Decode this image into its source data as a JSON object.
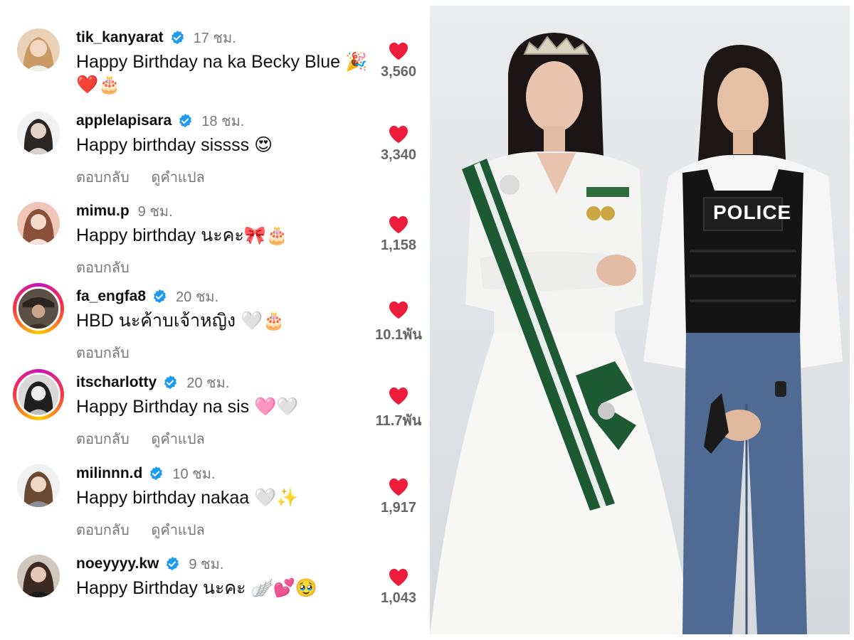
{
  "comments": [
    {
      "username": "tik_kanyarat",
      "verified": true,
      "time": "17 ชม.",
      "text": "Happy Birthday na ka Becky Blue 🎉❤️🎂",
      "actions": [],
      "likes": "3,560",
      "avatar_ring": false
    },
    {
      "username": "applelapisara",
      "verified": true,
      "time": "18 ชม.",
      "text": "Happy birthday sissss 😍",
      "actions": [
        "ตอบกลับ",
        "ดูคำแปล"
      ],
      "likes": "3,340",
      "avatar_ring": false
    },
    {
      "username": "mimu.p",
      "verified": false,
      "time": "9 ชม.",
      "text": "Happy birthday นะคะ🎀🎂",
      "actions": [
        "ตอบกลับ"
      ],
      "likes": "1,158",
      "avatar_ring": false
    },
    {
      "username": "fa_engfa8",
      "verified": true,
      "time": "20 ชม.",
      "text": "HBD นะค้าบเจ้าหญิง 🤍🎂",
      "actions": [
        "ตอบกลับ"
      ],
      "likes": "10.1พัน",
      "avatar_ring": true
    },
    {
      "username": "itscharlotty",
      "verified": true,
      "time": "20 ชม.",
      "text": "Happy Birthday na sis 🩷🤍",
      "actions": [
        "ตอบกลับ",
        "ดูคำแปล"
      ],
      "likes": "11.7พัน",
      "avatar_ring": true
    },
    {
      "username": "milinnn.d",
      "verified": true,
      "time": "10 ชม.",
      "text": "Happy birthday nakaa 🤍✨",
      "actions": [
        "ตอบกลับ",
        "ดูคำแปล"
      ],
      "likes": "1,917",
      "avatar_ring": false
    },
    {
      "username": "noeyyyy.kw",
      "verified": true,
      "time": "9 ชม.",
      "text": "Happy Birthday นะคะ 🪽💕🥹",
      "actions": [],
      "likes": "1,043",
      "avatar_ring": false
    }
  ],
  "photo": {
    "vest_label": "POLICE"
  },
  "colors": {
    "heart": "#ed1c3c",
    "verified": "#1d9bf0",
    "muted_text": "#777777",
    "gown": "#f7f7f5",
    "sash": "#1d5a33"
  }
}
